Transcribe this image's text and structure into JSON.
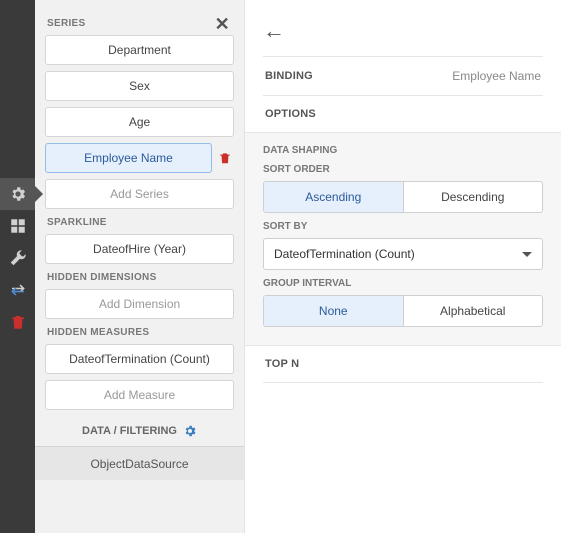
{
  "sidebar": {
    "items": [
      "gear",
      "layout",
      "wrench",
      "swap",
      "trash"
    ],
    "active": 0
  },
  "left": {
    "series_header": "SERIES",
    "series": [
      "Department",
      "Sex",
      "Age",
      "Employee Name"
    ],
    "series_selected_index": 3,
    "add_series": "Add Series",
    "sparkline_header": "SPARKLINE",
    "sparkline_item": "DateofHire (Year)",
    "hidden_dim_header": "HIDDEN DIMENSIONS",
    "add_dimension": "Add Dimension",
    "hidden_meas_header": "HIDDEN MEASURES",
    "hidden_meas_item": "DateofTermination (Count)",
    "add_measure": "Add Measure",
    "data_filtering": "DATA / FILTERING",
    "data_source": "ObjectDataSource"
  },
  "right": {
    "binding_label": "BINDING",
    "binding_value": "Employee Name",
    "options_label": "OPTIONS",
    "data_shaping_label": "DATA SHAPING",
    "sort_order_label": "SORT ORDER",
    "sort_order_options": [
      "Ascending",
      "Descending"
    ],
    "sort_order_selected": "Ascending",
    "sort_by_label": "SORT BY",
    "sort_by_value": "DateofTermination (Count)",
    "group_interval_label": "GROUP INTERVAL",
    "group_interval_options": [
      "None",
      "Alphabetical"
    ],
    "group_interval_selected": "None",
    "top_n_label": "TOP N"
  }
}
